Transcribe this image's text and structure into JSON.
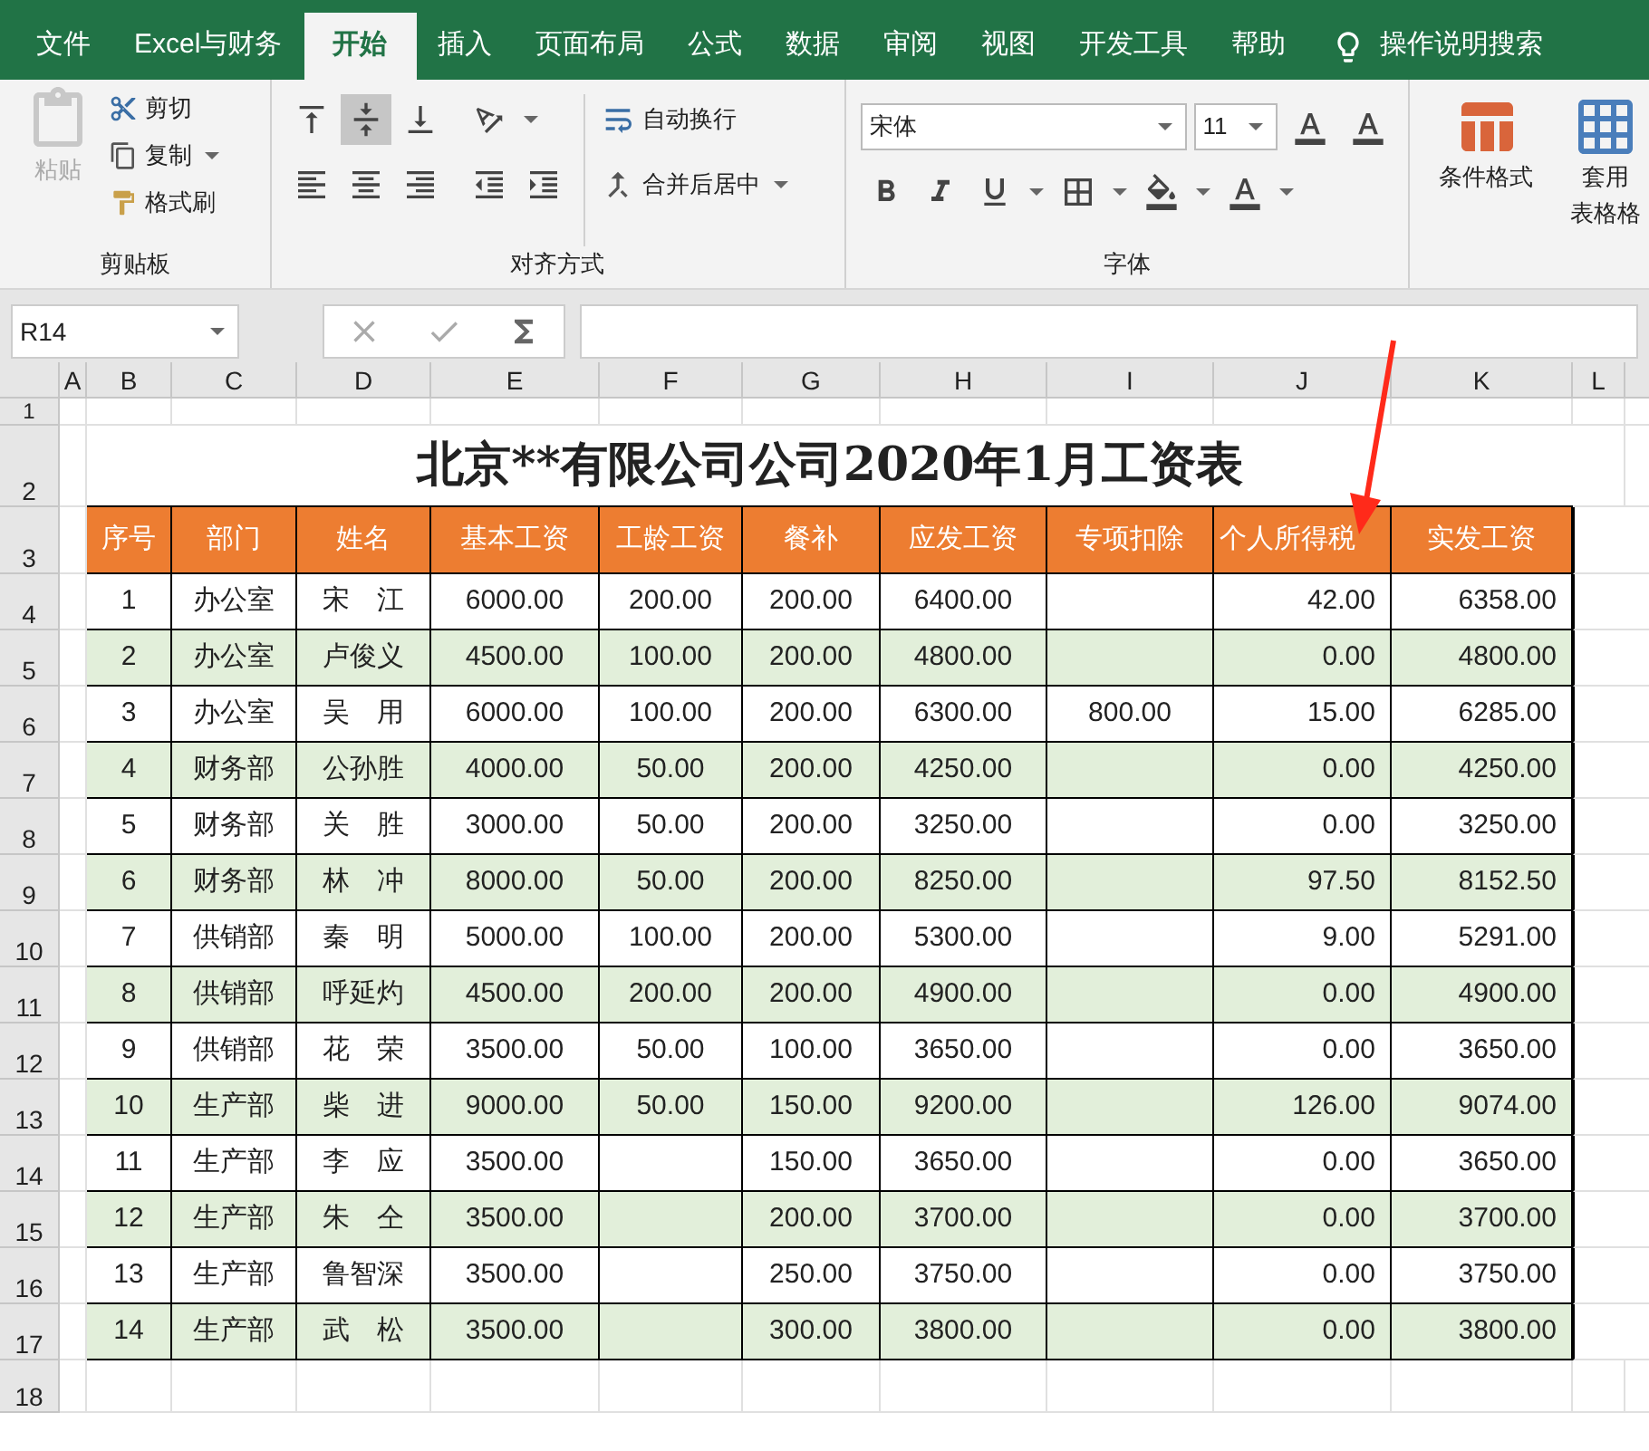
{
  "tabs": [
    {
      "label": "文件",
      "selected": false
    },
    {
      "label": "Excel与财务",
      "selected": false
    },
    {
      "label": "开始",
      "selected": true
    },
    {
      "label": "插入",
      "selected": false
    },
    {
      "label": "页面布局",
      "selected": false
    },
    {
      "label": "公式",
      "selected": false
    },
    {
      "label": "数据",
      "selected": false
    },
    {
      "label": "审阅",
      "selected": false
    },
    {
      "label": "视图",
      "selected": false
    },
    {
      "label": "开发工具",
      "selected": false
    },
    {
      "label": "帮助",
      "selected": false
    }
  ],
  "tell_me": "操作说明搜索",
  "ribbon": {
    "clipboard": {
      "paste": "粘贴",
      "cut": "剪切",
      "copy": "复制",
      "format_painter": "格式刷",
      "label": "剪贴板"
    },
    "alignment": {
      "vertical": [
        {
          "kind": "top",
          "selected": false
        },
        {
          "kind": "middle",
          "selected": true
        },
        {
          "kind": "bottom",
          "selected": false
        }
      ],
      "wrap_text": "自动换行",
      "merge_center": "合并后居中",
      "label": "对齐方式"
    },
    "font": {
      "name": "宋体",
      "size": "11",
      "label": "字体"
    },
    "styles": {
      "conditional_format": "条件格式",
      "table_format_1": "套用",
      "table_format_2": "表格格"
    }
  },
  "name_box": "R14",
  "column_headers": [
    "A",
    "B",
    "C",
    "D",
    "E",
    "F",
    "G",
    "H",
    "I",
    "J",
    "K",
    "L"
  ],
  "sheet_title": "北京**有限公司公司2020年1月工资表",
  "table": {
    "columns": [
      "序号",
      "部门",
      "姓名",
      "基本工资",
      "工龄工资",
      "餐补",
      "应发工资",
      "专项扣除",
      "个人所得税",
      "实发工资"
    ],
    "rows": [
      [
        "1",
        "办公室",
        "宋　江",
        "6000.00",
        "200.00",
        "200.00",
        "6400.00",
        null,
        "42.00",
        "6358.00"
      ],
      [
        "2",
        "办公室",
        "卢俊义",
        "4500.00",
        "100.00",
        "200.00",
        "4800.00",
        null,
        "0.00",
        "4800.00"
      ],
      [
        "3",
        "办公室",
        "吴　用",
        "6000.00",
        "100.00",
        "200.00",
        "6300.00",
        "800.00",
        "15.00",
        "6285.00"
      ],
      [
        "4",
        "财务部",
        "公孙胜",
        "4000.00",
        "50.00",
        "200.00",
        "4250.00",
        null,
        "0.00",
        "4250.00"
      ],
      [
        "5",
        "财务部",
        "关　胜",
        "3000.00",
        "50.00",
        "200.00",
        "3250.00",
        null,
        "0.00",
        "3250.00"
      ],
      [
        "6",
        "财务部",
        "林　冲",
        "8000.00",
        "50.00",
        "200.00",
        "8250.00",
        null,
        "97.50",
        "8152.50"
      ],
      [
        "7",
        "供销部",
        "秦　明",
        "5000.00",
        "100.00",
        "200.00",
        "5300.00",
        null,
        "9.00",
        "5291.00"
      ],
      [
        "8",
        "供销部",
        "呼延灼",
        "4500.00",
        "200.00",
        "200.00",
        "4900.00",
        null,
        "0.00",
        "4900.00"
      ],
      [
        "9",
        "供销部",
        "花　荣",
        "3500.00",
        "50.00",
        "100.00",
        "3650.00",
        null,
        "0.00",
        "3650.00"
      ],
      [
        "10",
        "生产部",
        "柴　进",
        "9000.00",
        "50.00",
        "150.00",
        "9200.00",
        null,
        "126.00",
        "9074.00"
      ],
      [
        "11",
        "生产部",
        "李　应",
        "3500.00",
        null,
        "150.00",
        "3650.00",
        null,
        "0.00",
        "3650.00"
      ],
      [
        "12",
        "生产部",
        "朱　仝",
        "3500.00",
        null,
        "200.00",
        "3700.00",
        null,
        "0.00",
        "3700.00"
      ],
      [
        "13",
        "生产部",
        "鲁智深",
        "3500.00",
        null,
        "250.00",
        "3750.00",
        null,
        "0.00",
        "3750.00"
      ],
      [
        "14",
        "生产部",
        "武　松",
        "3500.00",
        null,
        "300.00",
        "3800.00",
        null,
        "0.00",
        "3800.00"
      ]
    ]
  },
  "row_numbers": [
    "1",
    "2",
    "3",
    "4",
    "5",
    "6",
    "7",
    "8",
    "9",
    "10",
    "11",
    "12",
    "13",
    "14",
    "15",
    "16",
    "17",
    "18"
  ]
}
